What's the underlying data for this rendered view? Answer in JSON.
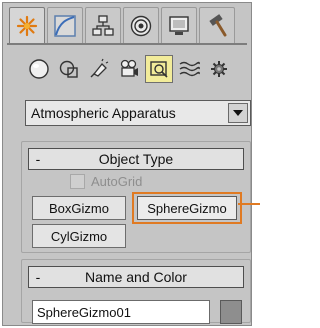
{
  "command_panel": {
    "tabs": [
      {
        "icon": "create-star-icon",
        "active": true
      },
      {
        "icon": "modify-curve-icon",
        "active": false
      },
      {
        "icon": "hierarchy-icon",
        "active": false
      },
      {
        "icon": "motion-icon",
        "active": false
      },
      {
        "icon": "display-monitor-icon",
        "active": false
      },
      {
        "icon": "utilities-hammer-icon",
        "active": false
      }
    ],
    "categories": [
      {
        "icon": "geometry-sphere-icon",
        "active": false
      },
      {
        "icon": "shapes-icon",
        "active": false
      },
      {
        "icon": "lights-icon",
        "active": false
      },
      {
        "icon": "cameras-icon",
        "active": false
      },
      {
        "icon": "helpers-icon",
        "active": true
      },
      {
        "icon": "space-warps-icon",
        "active": false
      },
      {
        "icon": "systems-gear-icon",
        "active": false
      }
    ],
    "category_dropdown": {
      "selected": "Atmospheric Apparatus"
    }
  },
  "object_type": {
    "collapse": "-",
    "title": "Object Type",
    "autogrid_label": "AutoGrid",
    "autogrid_checked": false,
    "buttons": {
      "box": "BoxGizmo",
      "sphere": "SphereGizmo",
      "cyl": "CylGizmo"
    },
    "selected_button": "SphereGizmo"
  },
  "name_and_color": {
    "collapse": "-",
    "title": "Name and Color",
    "name_value": "SphereGizmo01",
    "color": "#8e8e8e"
  },
  "colors": {
    "highlight": "#e07a22",
    "helpers_active": "#f2ec9a"
  }
}
